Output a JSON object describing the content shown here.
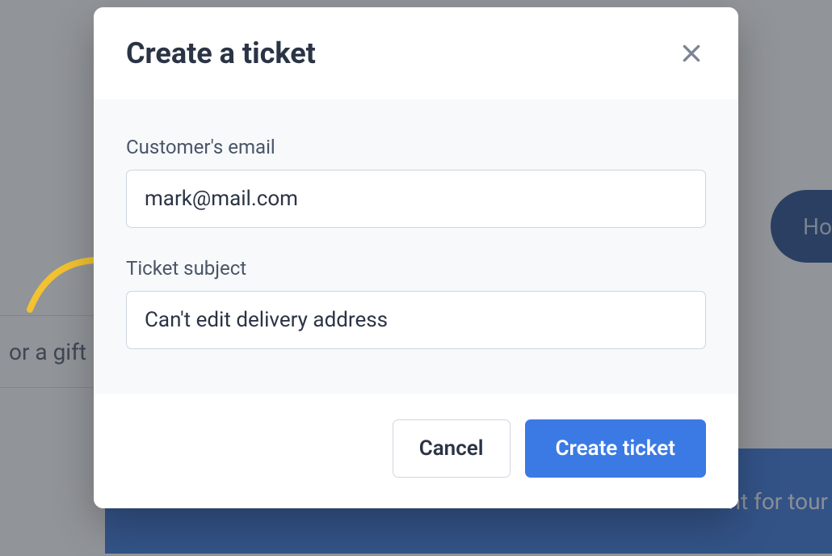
{
  "background": {
    "search_fragment": "or a gift id",
    "pill_fragment": "Ho",
    "banner_fragment": "nt for tour"
  },
  "modal": {
    "title": "Create a ticket",
    "email_label": "Customer's email",
    "email_value": "mark@mail.com",
    "subject_label": "Ticket subject",
    "subject_value": "Can't edit delivery address",
    "cancel_label": "Cancel",
    "submit_label": "Create ticket"
  }
}
